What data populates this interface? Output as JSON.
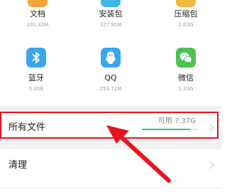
{
  "categories_top": [
    {
      "label": "文档",
      "size": "101.32M",
      "icon": "document-icon",
      "color": "#f2a33c"
    },
    {
      "label": "安装包",
      "size": "327.91M",
      "icon": "package-icon",
      "color": "#3fb6e6"
    },
    {
      "label": "压缩包",
      "size": "1.03G",
      "icon": "archive-icon",
      "color": "#f2b73c"
    }
  ],
  "categories_bottom": [
    {
      "label": "蓝牙",
      "size": "0.00B",
      "icon": "bluetooth-icon",
      "color": "#3aa6ec"
    },
    {
      "label": "QQ",
      "size": "253.72M",
      "icon": "qq-icon",
      "color": "#3aa6ec"
    },
    {
      "label": "微信",
      "size": "1.33G",
      "icon": "wechat-icon",
      "color": "#4dc152"
    }
  ],
  "all_files": {
    "label": "所有文件",
    "available": "可用 7.37G",
    "used_fraction": 0.85
  },
  "cleanup": {
    "label": "清理"
  },
  "colors": {
    "annotation": "#e8141d",
    "storage_bar": "#3ab4a8"
  }
}
